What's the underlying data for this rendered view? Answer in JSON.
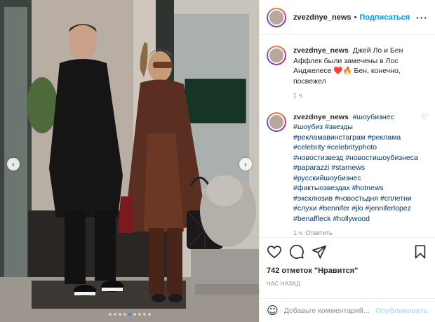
{
  "post": {
    "username": "zvezdnye_news",
    "follow_label": "Подписаться",
    "separator": "•",
    "more_label": "···"
  },
  "caption": {
    "username": "zvezdnye_news",
    "text": "Джей Ло и Бен Аффлек были замечены в Лос Анджелесе ❤️🔥 Бен, конечно, посвежел",
    "time": "1 ч."
  },
  "tags_comment": {
    "username": "zvezdnye_news",
    "hashtags": [
      "#шоубизнес",
      "#шоубиз",
      "#звезды",
      "#рекламавинстаграм",
      "#реклама",
      "#celebrity",
      "#celebrityphoto",
      "#новостизвезд",
      "#новостишоубизнеса",
      "#paparazzi",
      "#starnews",
      "#русскийшоубизнес",
      "#фактыозвездах",
      "#hotnews",
      "#эксклюзив",
      "#новостьдня",
      "#сплетни",
      "#слухи",
      "#bennifer",
      "#jlo",
      "#jenniferlopez",
      "#benaffleck",
      "#hollywood"
    ],
    "meta": "1 ч.   Ответить"
  },
  "actions": {
    "likes_label": "742 отметок \"Нравится\"",
    "time_ago": "ЧАС НАЗАД"
  },
  "comment_box": {
    "placeholder": "Добавьте комментарий...",
    "post_label": "Опубликовать"
  },
  "carousel": {
    "prev": "‹",
    "next": "›",
    "slide_count": 9,
    "active_index": 4
  }
}
